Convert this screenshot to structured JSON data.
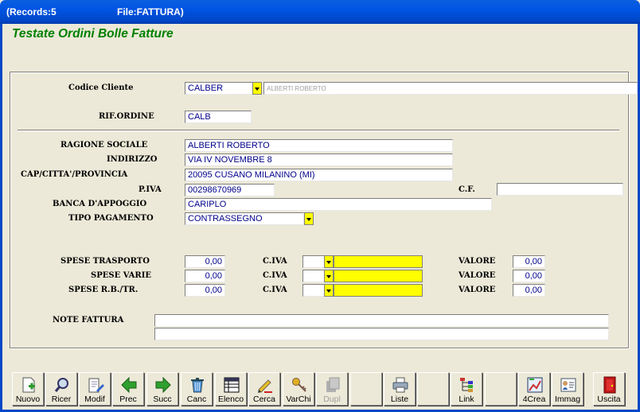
{
  "window": {
    "records_label": "(Records:5",
    "file_label": "File:FATTURA)"
  },
  "app_title": "Testate Ordini Bolle Fatture",
  "form": {
    "codice_cliente": {
      "label": "Codice Cliente",
      "value": "CALBER",
      "description": "ALBERTI ROBERTO"
    },
    "rif_ordine": {
      "label": "RIF.ORDINE",
      "value": "CALB"
    },
    "ragione_sociale": {
      "label": "RAGIONE SOCIALE",
      "value": "ALBERTI ROBERTO"
    },
    "indirizzo": {
      "label": "INDIRIZZO",
      "value": "VIA IV NOVEMBRE 8"
    },
    "cap_citta": {
      "label": "CAP/CITTA'/PROVINCIA",
      "value": "20095 CUSANO MILANINO (MI)"
    },
    "piva": {
      "label": "P.IVA",
      "value": "00298670969"
    },
    "cf": {
      "label": "C.F.",
      "value": ""
    },
    "banca": {
      "label": "BANCA D'APPOGGIO",
      "value": "CARIPLO"
    },
    "tipo_pagamento": {
      "label": "TIPO PAGAMENTO",
      "value": "CONTRASSEGNO"
    },
    "spese": [
      {
        "label": "SPESE TRASPORTO",
        "value": "0,00",
        "iva_label": "C.IVA",
        "iva": "",
        "valore_label": "VALORE",
        "valore": "0,00"
      },
      {
        "label": "SPESE VARIE",
        "value": "0,00",
        "iva_label": "C.IVA",
        "iva": "",
        "valore_label": "VALORE",
        "valore": "0,00"
      },
      {
        "label": "SPESE R.B./TR.",
        "value": "0,00",
        "iva_label": "C.IVA",
        "iva": "",
        "valore_label": "VALORE",
        "valore": "0,00"
      }
    ],
    "note": {
      "label": "NOTE FATTURA",
      "line1": "",
      "line2": ""
    }
  },
  "toolbar": [
    {
      "label": "Nuovo",
      "icon": "new-document-icon"
    },
    {
      "label": "Ricer",
      "icon": "magnifier-icon"
    },
    {
      "label": "Modif",
      "icon": "edit-document-icon"
    },
    {
      "label": "Prec",
      "icon": "arrow-left-icon"
    },
    {
      "label": "Succ",
      "icon": "arrow-right-icon"
    },
    {
      "label": "Canc",
      "icon": "trash-icon"
    },
    {
      "label": "Elenco",
      "icon": "list-icon"
    },
    {
      "label": "Cerca",
      "icon": "search-pen-icon"
    },
    {
      "label": "VarChi",
      "icon": "keys-icon"
    },
    {
      "label": "Dupl",
      "icon": "duplicate-icon",
      "disabled": true
    },
    {
      "label": "",
      "icon": ""
    },
    {
      "label": "Liste",
      "icon": "printer-icon"
    },
    {
      "label": "",
      "icon": ""
    },
    {
      "label": "Link",
      "icon": "link-tree-icon"
    },
    {
      "label": "",
      "icon": ""
    },
    {
      "label": "4Crea",
      "icon": "create-chart-icon"
    },
    {
      "label": "Immag",
      "icon": "image-card-icon"
    },
    {
      "label": "",
      "icon": ""
    },
    {
      "label": "Uscita",
      "icon": "exit-door-icon"
    }
  ],
  "colors": {
    "title_green": "#008000",
    "field_text": "#00008b",
    "dropdown_yellow": "#ffff00",
    "titlebar_blue": "#0054e3"
  }
}
